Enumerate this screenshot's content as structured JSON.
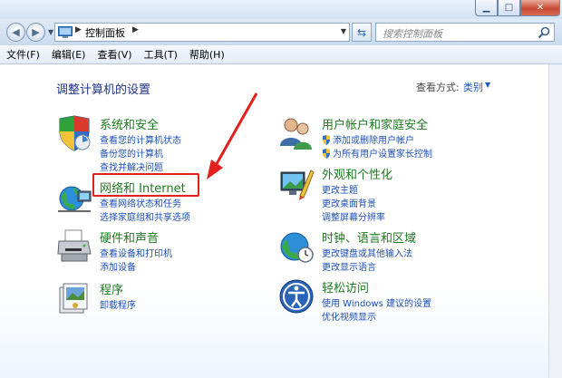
{
  "addressbar": {
    "path": "控制面板",
    "search_placeholder": "搜索控制面板"
  },
  "menu": [
    "文件(F)",
    "编辑(E)",
    "查看(V)",
    "工具(T)",
    "帮助(H)"
  ],
  "heading": "调整计算机的设置",
  "view": {
    "label": "查看方式:",
    "value": "类别"
  },
  "left_categories": [
    {
      "title": "系统和安全",
      "links": [
        "查看您的计算机状态",
        "备份您的计算机",
        "查找并解决问题"
      ]
    },
    {
      "title": "网络和 Internet",
      "links": [
        "查看网络状态和任务",
        "选择家庭组和共享选项"
      ]
    },
    {
      "title": "硬件和声音",
      "links": [
        "查看设备和打印机",
        "添加设备"
      ]
    },
    {
      "title": "程序",
      "links": [
        "卸载程序"
      ]
    }
  ],
  "right_categories": [
    {
      "title": "用户帐户和家庭安全",
      "links": [
        "添加或删除用户帐户",
        "为所有用户设置家长控制"
      ]
    },
    {
      "title": "外观和个性化",
      "links": [
        "更改主题",
        "更改桌面背景",
        "调整屏幕分辨率"
      ]
    },
    {
      "title": "时钟、语言和区域",
      "links": [
        "更改键盘或其他输入法",
        "更改显示语言"
      ]
    },
    {
      "title": "轻松访问",
      "links": [
        "使用 Windows 建议的设置",
        "优化视频显示"
      ]
    }
  ],
  "colors": {
    "category_title": "#1e7a20",
    "link": "#1c4fb5",
    "heading": "#1e3287",
    "annotation": "#e3201c"
  }
}
